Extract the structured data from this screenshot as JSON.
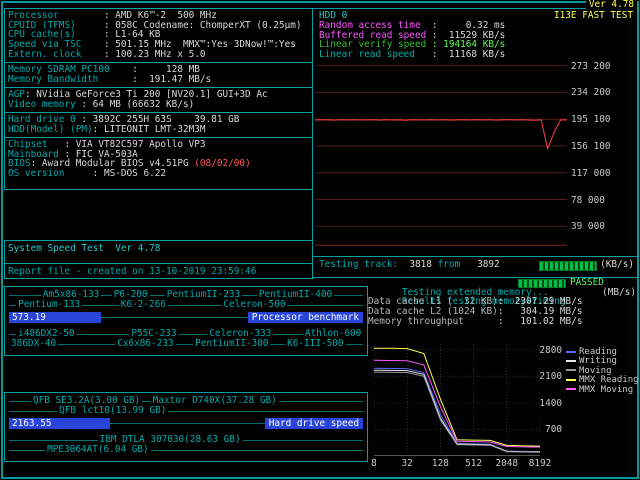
{
  "screen": {
    "ver_top": "Ver 4.78"
  },
  "palette": {
    "cyan": "#00AAAA",
    "magenta": "#FF55FF",
    "green": "#55FF55",
    "yellow": "#FFFF55",
    "red": "#FF5555",
    "bar_blue": "#2945D8",
    "value_white": "#D8D8D8"
  },
  "sysinfo": {
    "rows": [
      {
        "label": "Processor        ",
        "value": ": AMD K6™-2  500 MHz"
      },
      {
        "label": "CPUID (TFMS)     ",
        "value": ": 058C Codename: ChomperXT (0.25µm)"
      },
      {
        "label": "CPU cache(s)     ",
        "value": ": L1-64 KB"
      },
      {
        "label": "Speed via TSC    ",
        "value": ": 501.15 MHz  MMX™:Yes 3DNow!™:Yes"
      },
      {
        "label": "Extern. clock    ",
        "value": ": 100.23 MHz x 5.0"
      }
    ]
  },
  "memory": {
    "rows": [
      {
        "label": "Memory SDRAM PC100    ",
        "value": ":     128 MB"
      },
      {
        "label": "Memory Bandwidth      ",
        "value": ":  191.47 MB/s"
      }
    ]
  },
  "agp": {
    "rows": [
      {
        "label": "AGP",
        "value": ": NVidia GeForce3 Ti 200 [NV20.1] GUI+3D Ac"
      },
      {
        "label": "Video memory ",
        "value": ": 64 MB (66632 KB/s)"
      }
    ]
  },
  "hdd_info": {
    "rows": [
      {
        "label": "Hard drive 0 ",
        "value": ": 3892C 255H 63S    39.81 GB"
      },
      {
        "label": "HDD(Model) (PM)",
        "value": ": LITEONIT LMT-32M3M"
      }
    ]
  },
  "board": {
    "rows": [
      {
        "label": "Chipset   ",
        "value": ": VIA VT82C597 Apollo VP3",
        "date": ""
      },
      {
        "label": "Mainboard ",
        "value": ": FIC VA-503A",
        "date": ""
      },
      {
        "label": "BIOS",
        "value": ": Award Modular BIOS v4.51PG ",
        "date": "(08/02/00)"
      },
      {
        "label": "OS version     ",
        "value": ": MS-DOS 6.22",
        "date": ""
      }
    ]
  },
  "app": {
    "title": "System Speed Test  Ver 4.78",
    "report": "Report file - created on 13-10-2019 23:59:46"
  },
  "hdd_test": {
    "title": "HDD 0",
    "badge": "I13E FAST TEST",
    "metrics": [
      {
        "label": "Random access time  ",
        "value": ":     0.32 ms"
      },
      {
        "label": "Buffered read speed ",
        "value": ":  11529 KB/s"
      },
      {
        "label": "Linear verify speed ",
        "value": ": 194164 KB/s"
      },
      {
        "label": "Linear read speed   ",
        "value": ":  11168 KB/s"
      }
    ],
    "track": {
      "label": "Testing track:",
      "current": "  3818",
      "from_word": " from ",
      "total": "  3892",
      "unit": "(KB/s)"
    }
  },
  "mem_test": {
    "testing_label": "Testing extended memory...",
    "passed": "PASSED",
    "results_label": "Results testing memory+timing",
    "unit": "(MB/s)",
    "rows": [
      {
        "label": "Data cache L1 (  32 KB)",
        "value": ":  2307.29 MB/s"
      },
      {
        "label": "Data cache L2 (1024 KB)",
        "value": ":   304.19 MB/s"
      },
      {
        "label": "Memory throughput      ",
        "value": ":   101.02 MB/s"
      }
    ]
  },
  "cpu_bench": {
    "bar_value": "573.19",
    "bar_label": "Processor benchmark",
    "bar_frac": 0.26,
    "rows_above": [
      [
        {
          "t": "Am5x86-133",
          "x": 0.09
        },
        {
          "t": "P6-200",
          "x": 0.29
        },
        {
          "t": "PentiumII-233",
          "x": 0.44
        },
        {
          "t": "PentiumII-400",
          "x": 0.7
        }
      ],
      [
        {
          "t": "Pentium-133",
          "x": 0.02
        },
        {
          "t": "K6-2-266",
          "x": 0.31
        },
        {
          "t": "Celeron-500",
          "x": 0.6
        }
      ]
    ],
    "rows_below": [
      [
        {
          "t": "i486DX2-50",
          "x": 0.02
        },
        {
          "t": "P55C-233",
          "x": 0.34
        },
        {
          "t": "Celeron-333",
          "x": 0.56
        },
        {
          "t": "Athlon-600",
          "x": 0.83
        }
      ],
      [
        {
          "t": "386DX-40",
          "x": 0.0
        },
        {
          "t": "Cx6x86-233",
          "x": 0.3
        },
        {
          "t": "PentiumII-300",
          "x": 0.52
        },
        {
          "t": "K6-III-500",
          "x": 0.78
        }
      ]
    ]
  },
  "hdd_bench": {
    "bar_value": "2163.55",
    "bar_label": "Hard drive speed",
    "bar_frac": 0.285,
    "rows_above": [
      [
        {
          "t": "QFB SE3.2A(3.00 GB)",
          "x": 0.062
        },
        {
          "t": "Maxtor D740X(37.28 GB)",
          "x": 0.4
        }
      ],
      [
        {
          "t": "QFB lct10(13.99 GB)",
          "x": 0.136
        }
      ]
    ],
    "rows_below": [
      [
        {
          "t": "IBM DTLA 307030(28.63 GB)",
          "x": 0.25
        }
      ],
      [
        {
          "t": "MPE3064AT(6.04 GB)",
          "x": 0.102
        }
      ]
    ]
  },
  "chart_data": [
    {
      "id": "hdd_linear_read_graph",
      "type": "line",
      "ylim": [
        0,
        280000
      ],
      "ytick_values": [
        273200,
        234200,
        195100,
        156100,
        117000,
        78000,
        39000
      ],
      "ytick_labels": [
        "273 200",
        "234 200",
        "195 100",
        "156 100",
        "117 000",
        "78 000",
        "39 000"
      ],
      "grid_color": "#5a1a1a",
      "unit": "KB/s",
      "series": [
        {
          "name": "Linear verify speed",
          "color": "#ff4040",
          "values": [
            193900,
            194300,
            194100,
            193800,
            194200,
            194000,
            194400,
            193900,
            194100,
            194300,
            193800,
            194200,
            194000,
            194100,
            193700,
            194300,
            194100,
            193900,
            194200,
            194000,
            194300,
            193800,
            194100,
            194200,
            193900,
            194400,
            194000,
            194200,
            193800,
            194100,
            194300,
            193900,
            194200,
            194000,
            193700,
            194100,
            152000,
            176000,
            194000,
            194164
          ]
        },
        {
          "name": "Linear read speed",
          "color": "#8b2020",
          "values": [
            11168,
            11168
          ]
        }
      ]
    },
    {
      "id": "memory_cache_speed_graph",
      "type": "line",
      "xscale": "log2",
      "x": [
        8,
        16,
        32,
        64,
        128,
        256,
        512,
        1024,
        2048,
        4096,
        8192
      ],
      "xtick_values": [
        8,
        32,
        128,
        512,
        2048,
        8192
      ],
      "xtick_labels": [
        "8",
        "32",
        "128",
        "512",
        "2048",
        "8192"
      ],
      "ylim": [
        0,
        2950
      ],
      "ytick_values": [
        2800,
        2100,
        1400,
        700
      ],
      "ytick_labels": [
        "2800",
        "2100",
        "1400",
        "700"
      ],
      "grid_color": "#323232",
      "grid_dash": "1,2",
      "baseline": "#555555",
      "unit": "MB/s",
      "series": [
        {
          "name": "Reading",
          "color": "#5a6aff",
          "values": [
            2310,
            2308,
            2300,
            2200,
            1100,
            330,
            320,
            310,
            130,
            120,
            115
          ]
        },
        {
          "name": "Writing",
          "color": "#e8e8e8",
          "values": [
            2260,
            2255,
            2250,
            2150,
            1000,
            315,
            305,
            295,
            120,
            112,
            108
          ]
        },
        {
          "name": "Moving",
          "color": "#9a9a9a",
          "values": [
            2210,
            2205,
            2200,
            2100,
            950,
            300,
            290,
            285,
            112,
            106,
            101
          ]
        },
        {
          "name": "MMX Reading",
          "color": "#ffff55",
          "values": [
            2840,
            2840,
            2830,
            2700,
            1500,
            430,
            420,
            410,
            280,
            265,
            260
          ]
        },
        {
          "name": "MMX Moving",
          "color": "#ff55ff",
          "values": [
            2520,
            2515,
            2510,
            2400,
            1300,
            390,
            380,
            370,
            250,
            240,
            235
          ]
        }
      ]
    }
  ]
}
